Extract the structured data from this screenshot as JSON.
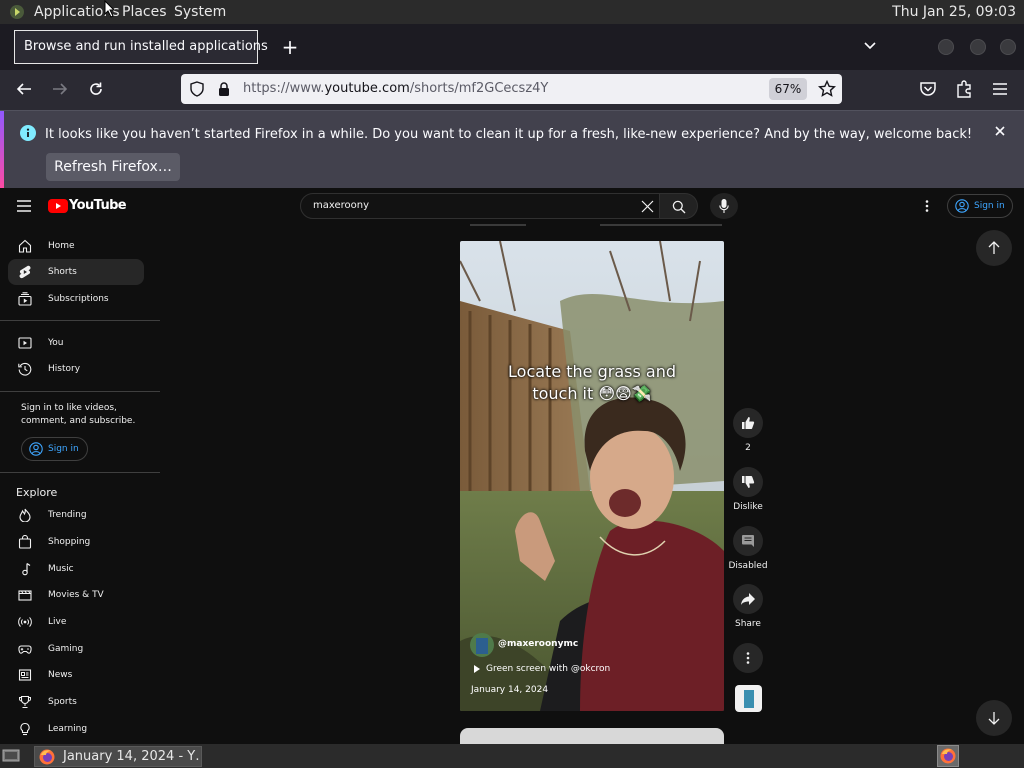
{
  "panel": {
    "applications": "Applications",
    "places": "Places",
    "system": "System",
    "clock": "Thu Jan 25, 09:03"
  },
  "tooltip": "Browse and run installed applications",
  "browser": {
    "url_prefix": "https://www.",
    "url_domain": "youtube.com",
    "url_path": "/shorts/mf2GCecsz4Y",
    "zoom": "67%"
  },
  "notification": {
    "message": "It looks like you haven’t started Firefox in a while. Do you want to clean it up for a fresh, like-new experience? And by the way, welcome back!",
    "button": "Refresh Firefox…"
  },
  "youtube": {
    "logo_text": "YouTube",
    "search_value": "maxeroony",
    "signin": "Sign in",
    "sidebar_main": [
      {
        "label": "Home",
        "icon": "home-icon"
      },
      {
        "label": "Shorts",
        "icon": "shorts-icon"
      },
      {
        "label": "Subscriptions",
        "icon": "subscriptions-icon"
      }
    ],
    "sidebar_you": [
      {
        "label": "You",
        "icon": "you-icon"
      },
      {
        "label": "History",
        "icon": "history-icon"
      }
    ],
    "signin_prompt": "Sign in to like videos, comment, and subscribe.",
    "explore_heading": "Explore",
    "explore": [
      {
        "label": "Trending",
        "icon": "trending-icon"
      },
      {
        "label": "Shopping",
        "icon": "shopping-icon"
      },
      {
        "label": "Music",
        "icon": "music-icon"
      },
      {
        "label": "Movies & TV",
        "icon": "movies-icon"
      },
      {
        "label": "Live",
        "icon": "live-icon"
      },
      {
        "label": "Gaming",
        "icon": "gaming-icon"
      },
      {
        "label": "News",
        "icon": "news-icon"
      },
      {
        "label": "Sports",
        "icon": "sports-icon"
      },
      {
        "label": "Learning",
        "icon": "learning-icon"
      }
    ],
    "short": {
      "caption_line1": "Locate the grass and",
      "caption_line2": "touch it",
      "channel": "@maxeroonymc",
      "sound": "Green screen with @okcron",
      "date": "January 14, 2024",
      "likes": "2",
      "dislike": "Dislike",
      "comments": "Disabled",
      "share": "Share"
    }
  },
  "taskbar": {
    "task_label": "January 14, 2024 - Y…"
  },
  "colors": {
    "yt_red": "#ff0000",
    "link_blue": "#3ea6ff",
    "background": "#0f0f0f"
  }
}
